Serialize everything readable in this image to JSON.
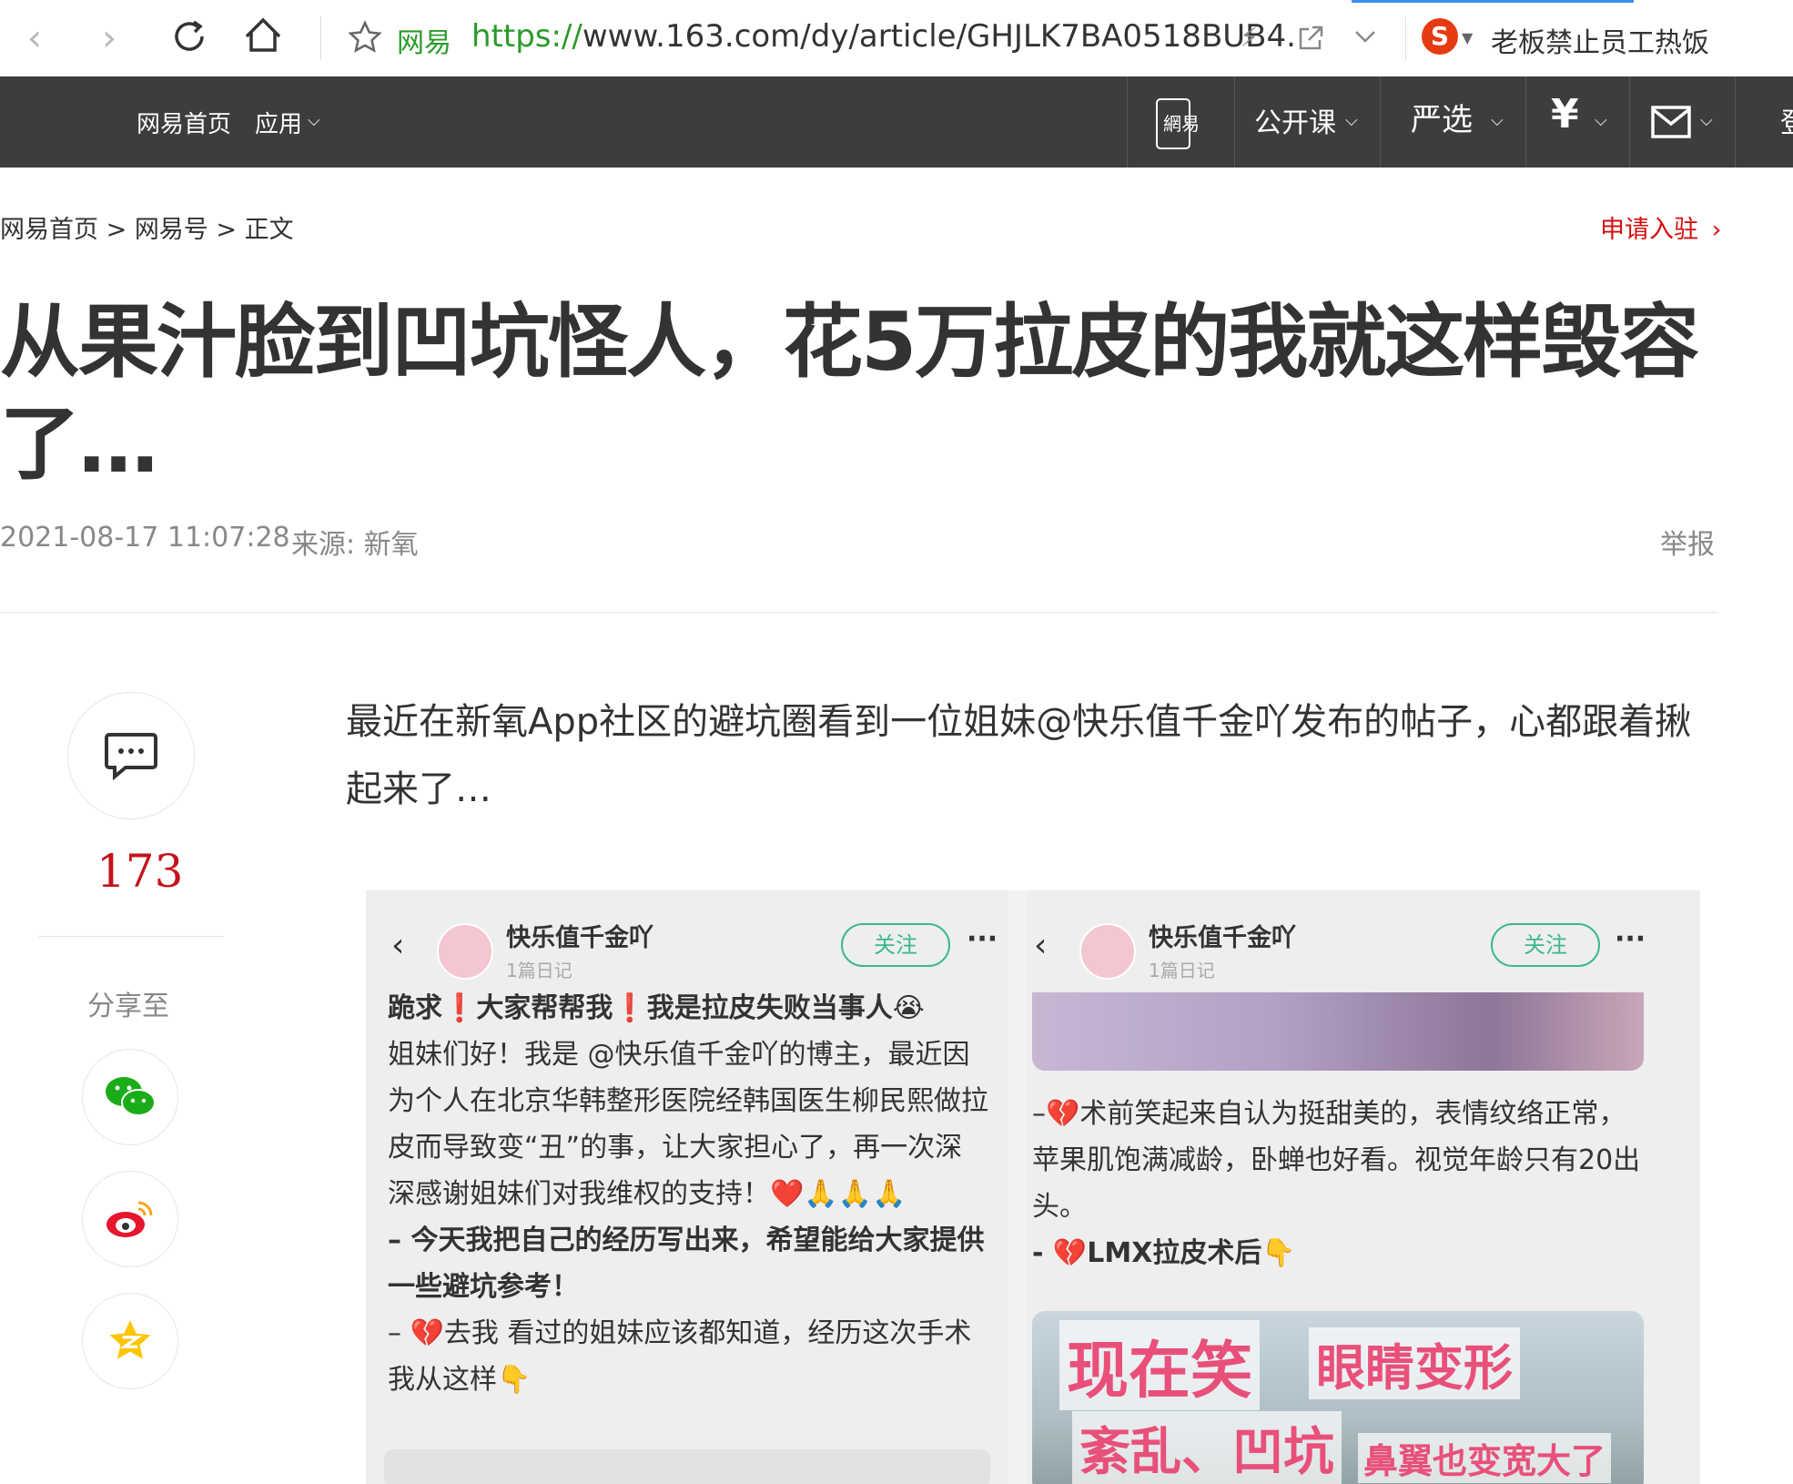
{
  "browser": {
    "site_name": "网易",
    "url_scheme": "https://",
    "url_rest": "www.163.com/dy/article/GHJLK7BA0518BUB4.",
    "search_text": "老板禁止员工热饭"
  },
  "nav": {
    "home": "网易首页",
    "apps": "应用",
    "mobile_badge": "網易",
    "open_course": "公开课",
    "yanxuan": "严选",
    "yuan_icon": "¥",
    "more": "登"
  },
  "breadcrumb": {
    "home": "网易首页",
    "sep1": ">",
    "section": "网易号",
    "sep2": ">",
    "current": "正文"
  },
  "apply_link": "申请入驻",
  "article": {
    "title": "从果汁脸到凹坑怪人，花5万拉皮的我就这样毁容了…",
    "datetime": "2021-08-17 11:07:28",
    "source": "来源: 新氧",
    "report": "举报",
    "lead": "最近在新氧App社区的避坑圈看到一位姐妹@快乐值千金吖发布的帖子，心都跟着揪起来了…"
  },
  "rail": {
    "comment_count": "173",
    "share_label": "分享至"
  },
  "embed": {
    "left": {
      "author": "快乐值千金吖",
      "sub": "1篇日记",
      "follow": "关注",
      "line1": "跪求❗大家帮帮我❗我是拉皮失败当事人😭",
      "line2": "姐妹们好！我是 @快乐值千金吖的博主，最近因为个人在北京华韩整形医院经韩国医生柳民熙做拉皮而导致变“丑”的事，让大家担心了，再一次深深感谢姐妹们对我维权的支持！❤️🙏🙏🙏",
      "line3": "– 今天我把自己的经历写出来，希望能给大家提供一些避坑参考！",
      "line4": "– 💔去我 看过的姐妹应该都知道，经历这次手术我从这样👇"
    },
    "right": {
      "author": "快乐值千金吖",
      "sub": "1篇日记",
      "follow": "关注",
      "line1": "–💔术前笑起来自认为挺甜美的，表情纹络正常，苹果肌饱满减龄，卧蝉也好看。视觉年龄只有20出头。",
      "line2": "- 💔LMX拉皮术后👇",
      "overlay1": "现在笑",
      "overlay2": "眼睛变形",
      "overlay3": "紊乱、凹坑",
      "overlay4": "鼻翼也变宽大了"
    }
  }
}
